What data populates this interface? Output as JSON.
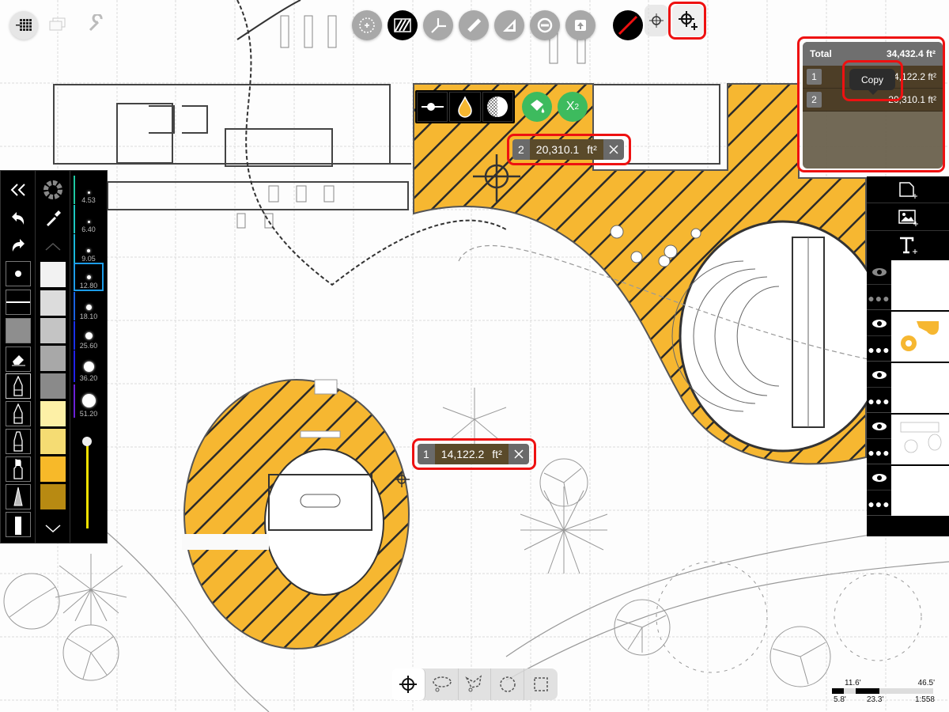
{
  "app": {
    "accent_color": "#ee1111",
    "hatch_color": "#f6b731"
  },
  "top_toolbar": {
    "left_buttons": [
      {
        "name": "grid-menu",
        "icon": "grid-icon"
      },
      {
        "name": "layers-stack",
        "icon": "stack-icon"
      },
      {
        "name": "tools",
        "icon": "wrench-icon"
      }
    ],
    "tools": [
      {
        "name": "transform",
        "icon": "move-arrows-icon",
        "active": false
      },
      {
        "name": "hatch-fill",
        "icon": "hatch-icon",
        "active": true
      },
      {
        "name": "angle",
        "icon": "angle-icon",
        "active": false
      },
      {
        "name": "ruler",
        "icon": "ruler-icon",
        "active": false
      },
      {
        "name": "set-square",
        "icon": "set-square-icon",
        "active": false
      },
      {
        "name": "subtract",
        "icon": "minus-circle-icon",
        "active": false
      },
      {
        "name": "stamp",
        "icon": "stamp-icon",
        "active": false
      }
    ],
    "right_tools": [
      {
        "name": "no-color",
        "icon": "no-fill-icon"
      },
      {
        "name": "crosshair",
        "icon": "crosshair-icon"
      },
      {
        "name": "add-measure-point",
        "icon": "crosshair-plus-icon",
        "highlighted": true
      }
    ]
  },
  "area_panel": {
    "total_label": "Total",
    "total_value": "34,432.4 ft²",
    "rows": [
      {
        "index": "1",
        "value": "14,122.2 ft²"
      },
      {
        "index": "2",
        "value": "20,310.1 ft²"
      }
    ],
    "tooltip": "Copy"
  },
  "measurements": [
    {
      "index": "2",
      "value": "20,310.1",
      "unit": "ft²"
    },
    {
      "index": "1",
      "value": "14,122.2",
      "unit": "ft²"
    }
  ],
  "style_popup": {
    "buttons": [
      "line-weight",
      "fill-color",
      "opacity"
    ],
    "fill_button": "fill-bucket",
    "superscript_label": "X",
    "superscript_exp": "2"
  },
  "tool_palette": {
    "brush_sizes": [
      "4.53",
      "6.40",
      "9.05",
      "12.80",
      "18.10",
      "25.60",
      "36.20",
      "51.20"
    ],
    "selected_size": "12.80",
    "swatches": [
      "#f2f2f2",
      "#dcdcdc",
      "#c4c4c4",
      "#a8a8a8",
      "#8a8a8a",
      "#fdf0a6",
      "#f5dc73",
      "#f7b929",
      "#b88a12"
    ],
    "opacity_slider": 1.0
  },
  "layers_panel": {
    "actions": [
      "add-page",
      "add-image",
      "add-text"
    ],
    "layers": [
      {
        "name": "layer-1",
        "visible": false
      },
      {
        "name": "layer-2-hatch",
        "visible": true
      },
      {
        "name": "layer-3",
        "visible": true
      },
      {
        "name": "layer-4-plan",
        "visible": true
      },
      {
        "name": "layer-5",
        "visible": true
      }
    ]
  },
  "selection_toolbar": {
    "tools": [
      "point",
      "lasso",
      "polygon-lasso",
      "ellipse",
      "rectangle"
    ],
    "active": "point"
  },
  "scale_bar": {
    "top_labels": [
      "11.6'",
      "46.5'"
    ],
    "bottom_labels": [
      "5.8'",
      "23.3'",
      "1:558"
    ]
  }
}
